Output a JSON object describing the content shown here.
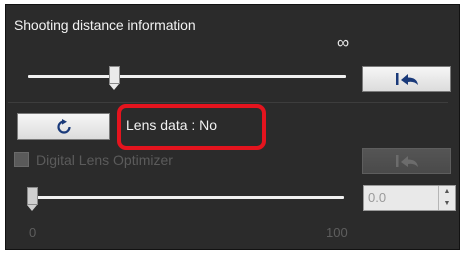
{
  "shooting_distance": {
    "title": "Shooting distance information",
    "infinity_symbol": "∞",
    "slider_value": 0.27,
    "reset_icon": "return-arrow-icon"
  },
  "lens": {
    "refresh_icon": "refresh-icon",
    "status_label": "Lens data : No"
  },
  "dlo": {
    "label": "Digital Lens Optimizer",
    "checked": false,
    "enabled": false,
    "slider_value": 0.0,
    "value_text": "0.0",
    "scale_min": "0",
    "scale_max": "100",
    "reset_icon": "return-arrow-icon"
  },
  "colors": {
    "panel_bg": "#2b2b2b",
    "highlight": "#e4141e"
  }
}
